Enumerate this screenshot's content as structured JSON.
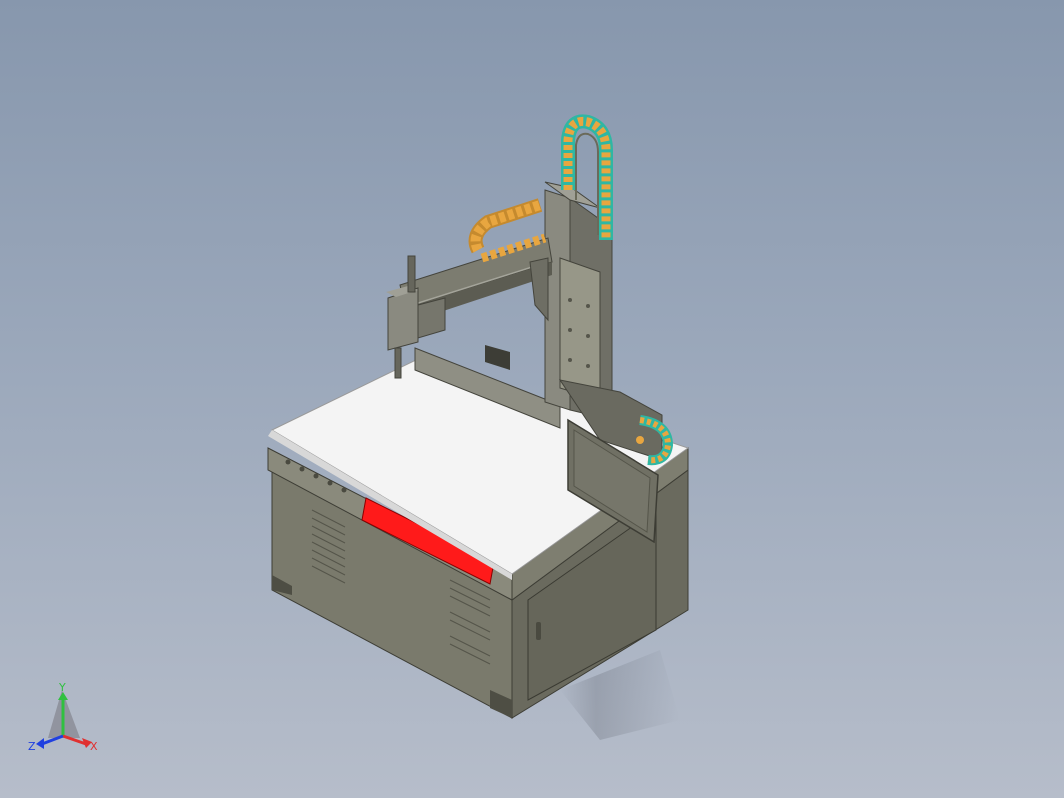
{
  "triad": {
    "y_label": "Y",
    "x_label": "X",
    "z_label": "Z"
  },
  "colors": {
    "background_top": "#8797ad",
    "background_bottom": "#b6bdca",
    "machine_body": "#6e6e62",
    "table_top": "#f4f4f4",
    "warning_strip": "#ff1a1a",
    "cable_chain_orange": "#e8a640",
    "cable_chain_teal": "#2fb7a3",
    "axis_x": "#e03030",
    "axis_y": "#30c040",
    "axis_z": "#2040e0"
  }
}
